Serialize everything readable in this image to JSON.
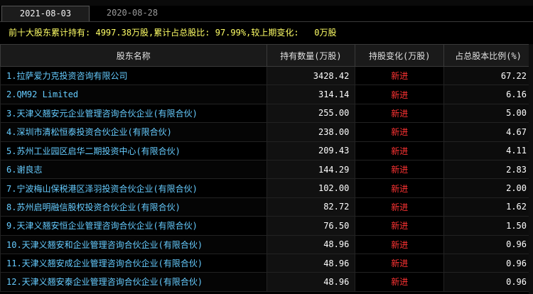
{
  "tabs": [
    {
      "label": "2021-08-03",
      "active": true
    },
    {
      "label": "2020-08-28",
      "active": false
    }
  ],
  "summary": {
    "label1": "前十大股东累计持有:",
    "value1": "4997.38万股",
    "label2": ",累计占总股比:",
    "value2": "97.99%",
    "label3": ",较上期变化:",
    "value3": "0万股"
  },
  "table": {
    "headers": [
      "股东名称",
      "持有数量(万股)",
      "持股变化(万股)",
      "占总股本比例(%)"
    ],
    "rows": [
      {
        "name": "1.拉萨爱力克投资咨询有限公司",
        "qty": "3428.42",
        "change": "新进",
        "pct": "67.22"
      },
      {
        "name": "2.QM92 Limited",
        "qty": "314.14",
        "change": "新进",
        "pct": "6.16"
      },
      {
        "name": "3.天津义翘安元企业管理咨询合伙企业(有限合伙)",
        "qty": "255.00",
        "change": "新进",
        "pct": "5.00"
      },
      {
        "name": "4.深圳市清松恒泰投资合伙企业(有限合伙)",
        "qty": "238.00",
        "change": "新进",
        "pct": "4.67"
      },
      {
        "name": "5.苏州工业园区启华二期投资中心(有限合伙)",
        "qty": "209.43",
        "change": "新进",
        "pct": "4.11"
      },
      {
        "name": "6.谢良志",
        "qty": "144.29",
        "change": "新进",
        "pct": "2.83"
      },
      {
        "name": "7.宁波梅山保税港区泽羽投资合伙企业(有限合伙)",
        "qty": "102.00",
        "change": "新进",
        "pct": "2.00"
      },
      {
        "name": "8.苏州启明融信股权投资合伙企业(有限合伙)",
        "qty": "82.72",
        "change": "新进",
        "pct": "1.62"
      },
      {
        "name": "9.天津义翘安恒企业管理咨询合伙企业(有限合伙)",
        "qty": "76.50",
        "change": "新进",
        "pct": "1.50"
      },
      {
        "name": "10.天津义翘安和企业管理咨询合伙企业(有限合伙)",
        "qty": "48.96",
        "change": "新进",
        "pct": "0.96"
      },
      {
        "name": "11.天津义翘安成企业管理咨询合伙企业(有限合伙)",
        "qty": "48.96",
        "change": "新进",
        "pct": "0.96"
      },
      {
        "name": "12.天津义翘安泰企业管理咨询合伙企业(有限合伙)",
        "qty": "48.96",
        "change": "新进",
        "pct": "0.96"
      }
    ]
  },
  "colors": {
    "name_text": "#66ccff",
    "summary_text": "#ffff66",
    "change_text": "#ff3333",
    "number_text": "#ffffff",
    "background": "#000000"
  }
}
